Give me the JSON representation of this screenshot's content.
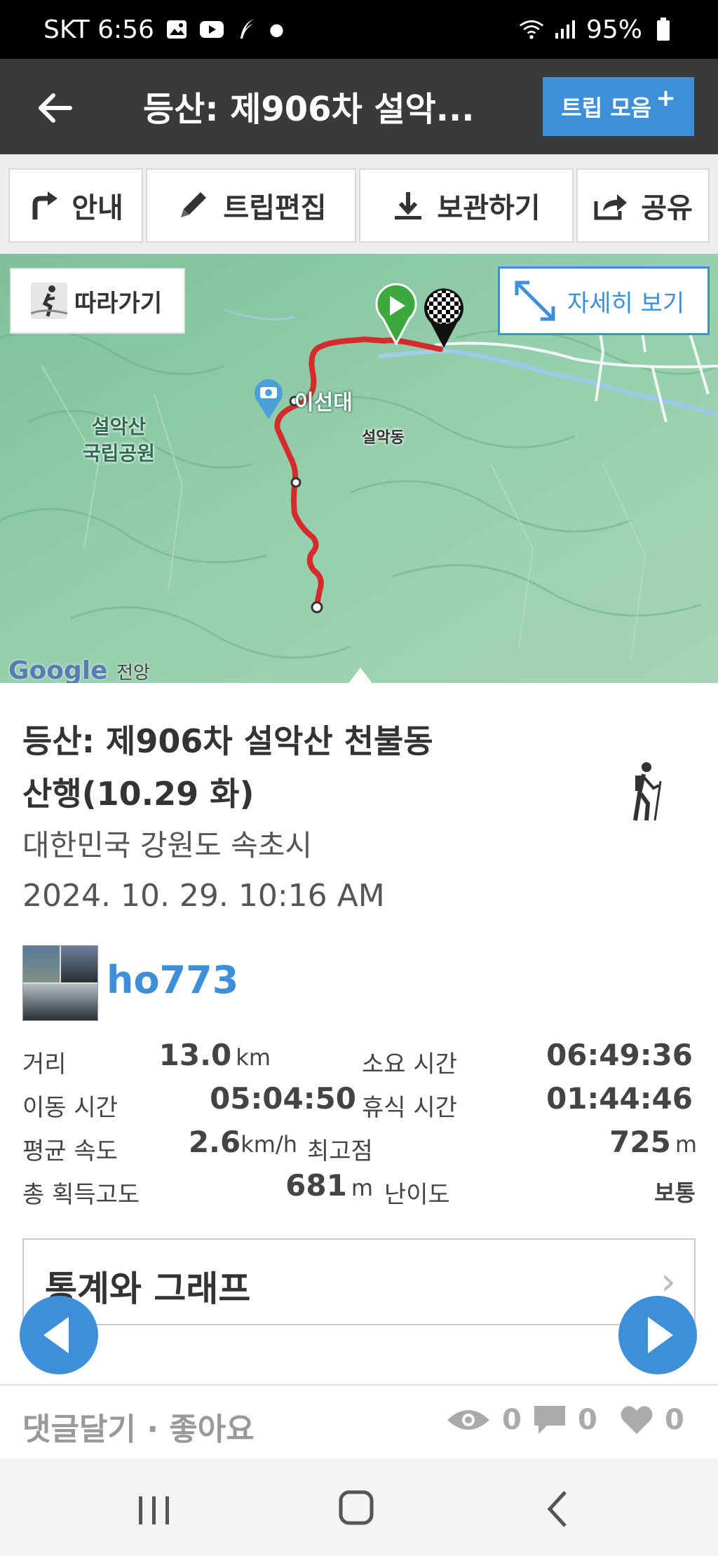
{
  "status": {
    "carrier_time": "SKT 6:56",
    "battery": "95%"
  },
  "header": {
    "title": "등산: 제906차 설악...",
    "trip_collection_label": "트립 모음",
    "plus": "+"
  },
  "actions": [
    {
      "label": "안내",
      "icon": "turn-right-icon"
    },
    {
      "label": "트립편집",
      "icon": "pencil-icon"
    },
    {
      "label": "보관하기",
      "icon": "download-icon"
    },
    {
      "label": "공유",
      "icon": "share-icon"
    }
  ],
  "map": {
    "follow_label": "따라가기",
    "detail_label": "자세히 보기",
    "place_label": "이선대",
    "valley_label": "설악동",
    "park_label": "설악산\n국립공원",
    "google": "Google",
    "bottom_label": "전앙"
  },
  "trip": {
    "title": "등산: 제906차 설악산 천불동 산행(10.29 화)",
    "location": "대한민국 강원도 속초시",
    "datetime": "2024. 10. 29. 10:16 AM",
    "user": "ho773",
    "activity_icon": "hiker-icon"
  },
  "stats": {
    "distance_label": "거리",
    "distance_value": "13.0",
    "distance_unit": "km",
    "total_time_label": "소요 시간",
    "total_time_value": "06:49:36",
    "moving_time_label": "이동 시간",
    "moving_time_value": "05:04:50",
    "rest_time_label": "휴식 시간",
    "rest_time_value": "01:44:46",
    "avg_speed_label": "평균 속도",
    "avg_speed_value": "2.6",
    "avg_speed_unit": "km/h",
    "max_alt_label": "최고점",
    "max_alt_value": "725",
    "max_alt_unit": "m",
    "gain_label": "총 획득고도",
    "gain_value": "681",
    "gain_unit": "m",
    "difficulty_label": "난이도",
    "difficulty_value": "보통"
  },
  "stats_graph_label": "통계와 그래프",
  "footer": {
    "comment_like": "댓글달기 · 좋아요",
    "views": "0",
    "comments": "0",
    "likes": "0"
  },
  "colors": {
    "accent": "#3d8fd9",
    "route": "#d62b2b",
    "topbar": "#3a3a3a",
    "map": "#8fcaa7"
  }
}
